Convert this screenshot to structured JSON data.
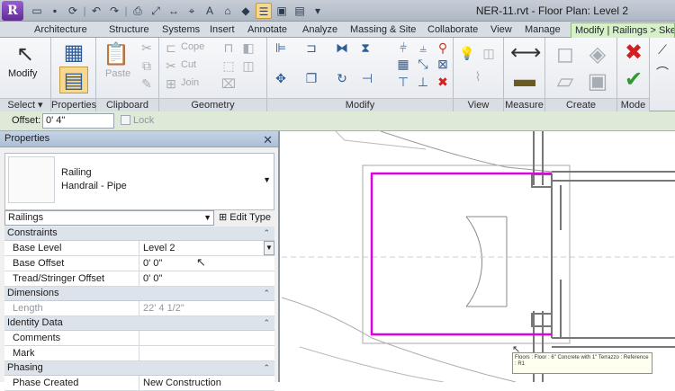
{
  "app": {
    "logo": "R",
    "window_title": "NER-11.rvt - Floor Plan: Level 2"
  },
  "qat": [
    "folder-open-icon",
    "save-icon",
    "sync-icon",
    "undo-icon",
    "redo-icon",
    "print-icon",
    "measure-icon",
    "dimension-icon",
    "tag-icon",
    "text-icon",
    "3d-view-icon",
    "section-icon",
    "thin-lines-icon",
    "close-windows-icon",
    "switch-windows-icon",
    "dropdown-icon"
  ],
  "tabs": [
    "Architecture",
    "Structure",
    "Systems",
    "Insert",
    "Annotate",
    "Analyze",
    "Massing & Site",
    "Collaborate",
    "View",
    "Manage",
    "Modify | Railings > Sket"
  ],
  "panels": {
    "select": "Select",
    "properties": "Properties",
    "clipboard": "Clipboard",
    "geometry": "Geometry",
    "modify": "Modify",
    "view": "View",
    "measure": "Measure",
    "create": "Create",
    "mode": "Mode"
  },
  "ribbon": {
    "modify_label": "Modify",
    "paste_label": "Paste",
    "cope_label": "Cope",
    "cut_label": "Cut",
    "join_label": "Join"
  },
  "options_bar": {
    "offset_label": "Offset:",
    "offset_value": "0'  4\"",
    "lock_label": "Lock"
  },
  "properties": {
    "title": "Properties",
    "type_family": "Railing",
    "type_name": "Handrail - Pipe",
    "selector": "Railings",
    "edit_type": "Edit Type",
    "groups": [
      {
        "name": "Constraints",
        "rows": [
          {
            "k": "Base Level",
            "v": "Level 2"
          },
          {
            "k": "Base Offset",
            "v": "0'  0\""
          },
          {
            "k": "Tread/Stringer Offset",
            "v": "0'  0\""
          }
        ]
      },
      {
        "name": "Dimensions",
        "rows": [
          {
            "k": "Length",
            "v": "22'  4 1/2\""
          }
        ]
      },
      {
        "name": "Identity Data",
        "rows": [
          {
            "k": "Comments",
            "v": ""
          },
          {
            "k": "Mark",
            "v": ""
          }
        ]
      },
      {
        "name": "Phasing",
        "rows": [
          {
            "k": "Phase Created",
            "v": "New Construction"
          }
        ]
      }
    ]
  },
  "tooltip": "Floors : Floor : 6\" Concrete with 1\" Terrazzo : Reference : R1",
  "colors": {
    "sketch": "#e000e0",
    "ribbon_accent": "#d7f0c8",
    "panel_bar": "#d9dee5"
  }
}
